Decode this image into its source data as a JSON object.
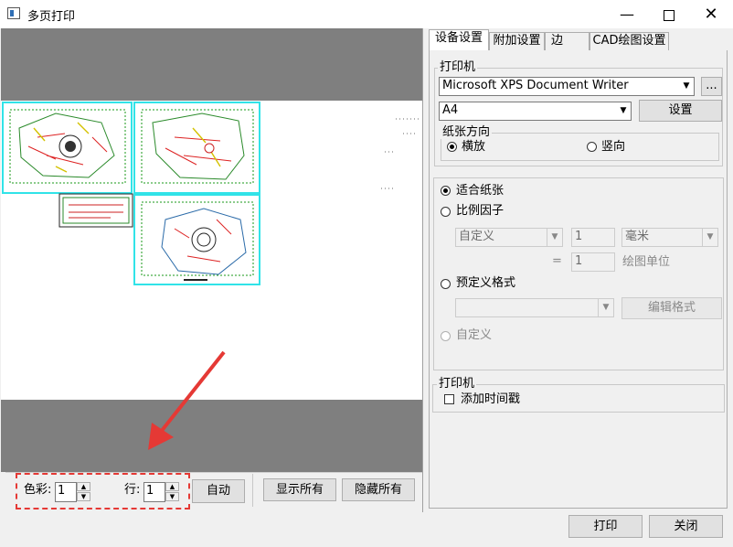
{
  "window": {
    "title": "多页打印"
  },
  "preview": {
    "spinner_color_label": "色彩:",
    "spinner_color_value": "1",
    "spinner_row_label": "行:",
    "spinner_row_value": "1",
    "auto_label": "自动",
    "show_all_label": "显示所有",
    "hide_all_label": "隐藏所有"
  },
  "tabs": [
    {
      "label": "设备设置"
    },
    {
      "label": "附加设置"
    },
    {
      "label": "边"
    },
    {
      "label": "CAD绘图设置"
    }
  ],
  "printer": {
    "group_label": "打印机",
    "device": "Microsoft XPS Document Writer",
    "browse_label": "...",
    "paper": "A4",
    "setup_label": "设置",
    "orientation_label": "纸张方向",
    "landscape_label": "横放",
    "portrait_label": "竖向"
  },
  "scale": {
    "fit_label": "适合纸张",
    "factor_label": "比例因子",
    "factor_combo": "自定义",
    "factor_value": "1",
    "unit_combo": "毫米",
    "equals": "=",
    "drawing_value": "1",
    "drawing_units_label": "绘图单位",
    "predefined_label": "预定义格式",
    "predefined_combo": "",
    "edit_format_label": "编辑格式",
    "custom_label": "自定义"
  },
  "stamp": {
    "group_label": "打印机",
    "timestamp_label": "添加时间戳"
  },
  "footer": {
    "print_label": "打印",
    "close_label": "关闭"
  },
  "colors": {
    "accent": "#0078d7",
    "highlight_dash": "#e53935",
    "page_border": "#31e3e8",
    "arrow": "#e53935"
  }
}
